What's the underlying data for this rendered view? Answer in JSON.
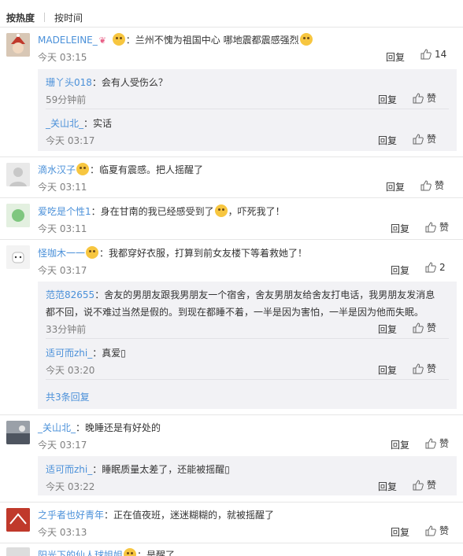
{
  "tabs": {
    "hot": "按热度",
    "time": "按时间"
  },
  "labels": {
    "reply": "回复",
    "like": "赞"
  },
  "comments": [
    {
      "user": "MADELEINE_",
      "text": "：兰州不愧为祖国中心 哪地震都震感强烈",
      "time": "今天 03:15",
      "likes": "14"
    },
    {
      "user": "珊丫头018",
      "text": "：会有人受伤么？",
      "time": "59分钟前"
    },
    {
      "user": "_关山北_",
      "text": "：实话",
      "time": "今天 03:17"
    },
    {
      "user": "滴水汉子",
      "text": "：临夏有震感。把人摇醒了",
      "time": "今天 03:11"
    },
    {
      "user": "爱吃是个性1",
      "text": "：身在甘南的我已经感受到了",
      "text2": "，吓死我了！",
      "time": "今天 03:11"
    },
    {
      "user": "怪咖木一一",
      "text": "：我都穿好衣服，打算到前女友楼下等着救她了！",
      "time": "今天 03:17",
      "likes": "2"
    },
    {
      "user": "范范82655",
      "text": "：舍友的男朋友跟我男朋友一个宿舍，舍友男朋友给舍友打电话，我男朋友发消息",
      "text_line2": "都不回，说不难过当然是假的。到现在都睡不着，一半是因为害怕，一半是因为他而失眠。",
      "time": "33分钟前"
    },
    {
      "user": "适可而zhi_",
      "text": "：真爱▯",
      "time": "今天 03:20"
    },
    {
      "more": "共3条回复"
    },
    {
      "user": "_关山北_",
      "text": "：晚睡还是有好处的",
      "time": "今天 03:17"
    },
    {
      "user": "适可而zhi_",
      "text": "：睡眠质量太差了，还能被摇醒▯",
      "time": "今天 03:22"
    },
    {
      "user": "之乎者也好青年",
      "text": "：正在值夜班，迷迷糊糊的，就被摇醒了",
      "time": "今天 03:13"
    },
    {
      "user": "阳光下的仙人球姐姐",
      "text": "：是醒了"
    }
  ]
}
